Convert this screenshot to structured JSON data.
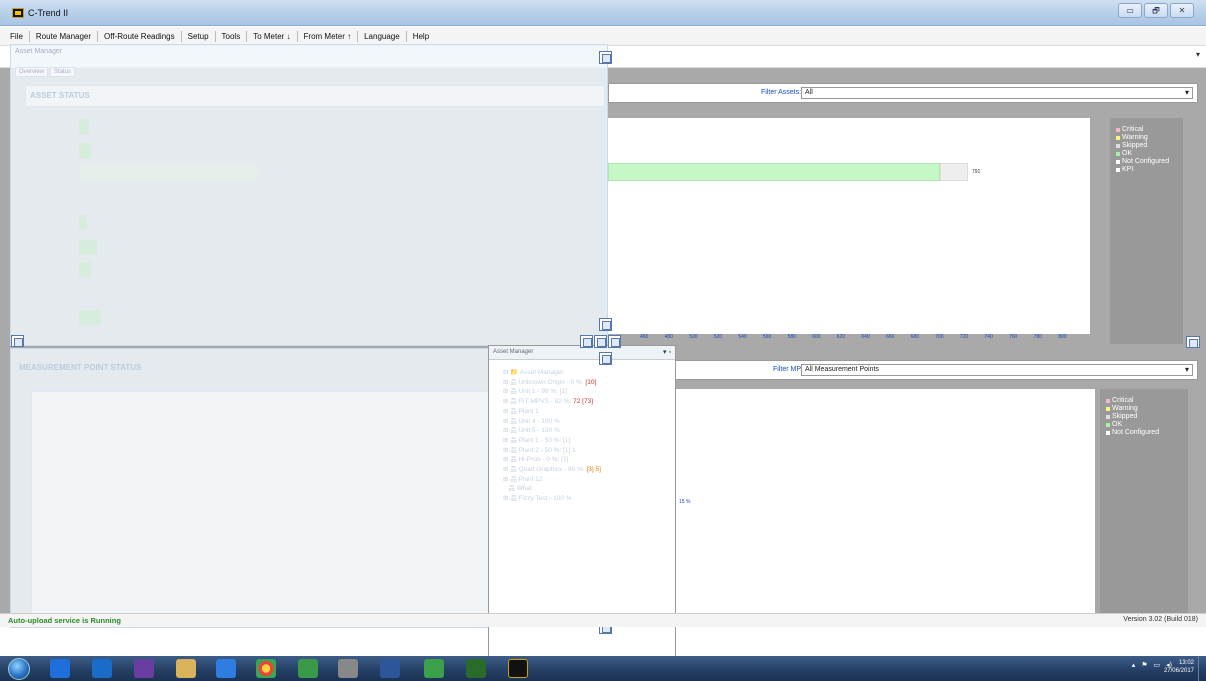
{
  "window": {
    "title": "C-Trend II",
    "controls": [
      "▭",
      "🗗",
      "✕"
    ]
  },
  "menu": [
    "File",
    "Route Manager",
    "Off-Route Readings",
    "Setup",
    "Tools",
    "To Meter ↓",
    "From Meter ↑",
    "Language",
    "Help"
  ],
  "asset_panel": {
    "filter_label": "Filter Assets:",
    "filter_value": "All",
    "bar_value_label": "791",
    "ok_fraction": 0.862,
    "legend": [
      {
        "label": "Critical",
        "color": "#f4b6c8"
      },
      {
        "label": "Warning",
        "color": "#f7f77a"
      },
      {
        "label": "Skipped",
        "color": "#dddddd"
      },
      {
        "label": "OK",
        "color": "#a8f0a8"
      },
      {
        "label": "Not Configured",
        "color": "#ffffff"
      },
      {
        "label": "KPI",
        "color": "#ffffff"
      }
    ],
    "axis_ticks": [
      "460",
      "480",
      "500",
      "520",
      "540",
      "560",
      "580",
      "600",
      "620",
      "640",
      "660",
      "680",
      "700",
      "720",
      "740",
      "760",
      "780",
      "800"
    ]
  },
  "mp_panel": {
    "filter_label": "Filter MPs:",
    "filter_value": "All Measurement Points",
    "value_label": "15 %",
    "legend": [
      {
        "label": "Critical",
        "color": "#f4b6c8"
      },
      {
        "label": "Warning",
        "color": "#f7f77a"
      },
      {
        "label": "Skipped",
        "color": "#dddddd"
      },
      {
        "label": "OK",
        "color": "#a8f0a8"
      },
      {
        "label": "Not Configured",
        "color": "#ffffff"
      }
    ]
  },
  "overlay": {
    "caption": "Asset Manager",
    "tabs": [
      "Overview",
      "Status"
    ],
    "asset_status_title": "ASSET STATUS",
    "mp_status_title": "MEASUREMENT POINT STATUS"
  },
  "tree": {
    "header": "Asset Manager",
    "rows": [
      {
        "text": "Asset Manager",
        "suffix": ""
      },
      {
        "text": "Unknown Origin - 0 %:",
        "suffix": "[10]"
      },
      {
        "text": "Unit 1 - 99 %: [1]",
        "suffix": ""
      },
      {
        "text": "PIT-MPVS - 82 %:",
        "suffix": "72 [73]"
      },
      {
        "text": "Plant 1",
        "suffix": ""
      },
      {
        "text": "Unit 4 - 100 %",
        "suffix": ""
      },
      {
        "text": "Unit 5 - 100 %",
        "suffix": ""
      },
      {
        "text": "Plant 1 - 50 %: [1]",
        "suffix": ""
      },
      {
        "text": "Plant 2 - 50 %: [1] 1",
        "suffix": ""
      },
      {
        "text": "Hi-Prob - 0 %: [1]",
        "suffix": ""
      },
      {
        "text": "Quad Graphics - 80 %:",
        "suffix": "[3] 5]"
      },
      {
        "text": "Plant 12",
        "suffix": ""
      },
      {
        "text": "What",
        "suffix": ""
      },
      {
        "text": "Fizzy Test - 100 %",
        "suffix": ""
      }
    ]
  },
  "status": {
    "left": "Auto-upload service is Running",
    "right": "Version 3.02 (Build 018)"
  },
  "taskbar": {
    "time": "13:02",
    "date": "27/06/2017"
  }
}
